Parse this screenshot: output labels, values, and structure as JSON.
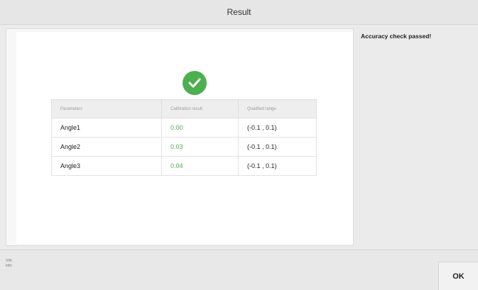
{
  "window": {
    "title": "Result"
  },
  "status": {
    "message": "Accuracy check passed!"
  },
  "icons": {
    "success": "check-circle-icon",
    "accent_color": "#4caf50"
  },
  "table": {
    "headers": [
      "Parameters",
      "Calibration result",
      "Qualified range"
    ],
    "rows": [
      {
        "parameter": "Angle1",
        "result": "0.00",
        "range": "(-0.1 , 0.1)"
      },
      {
        "parameter": "Angle2",
        "result": "0.03",
        "range": "(-0.1 , 0.1)"
      },
      {
        "parameter": "Angle3",
        "result": "0.04",
        "range": "(-0.1 , 0.1)"
      }
    ]
  },
  "footer": {
    "vin_label": "VIN:",
    "info_label": "Info:",
    "ok_label": "OK"
  }
}
